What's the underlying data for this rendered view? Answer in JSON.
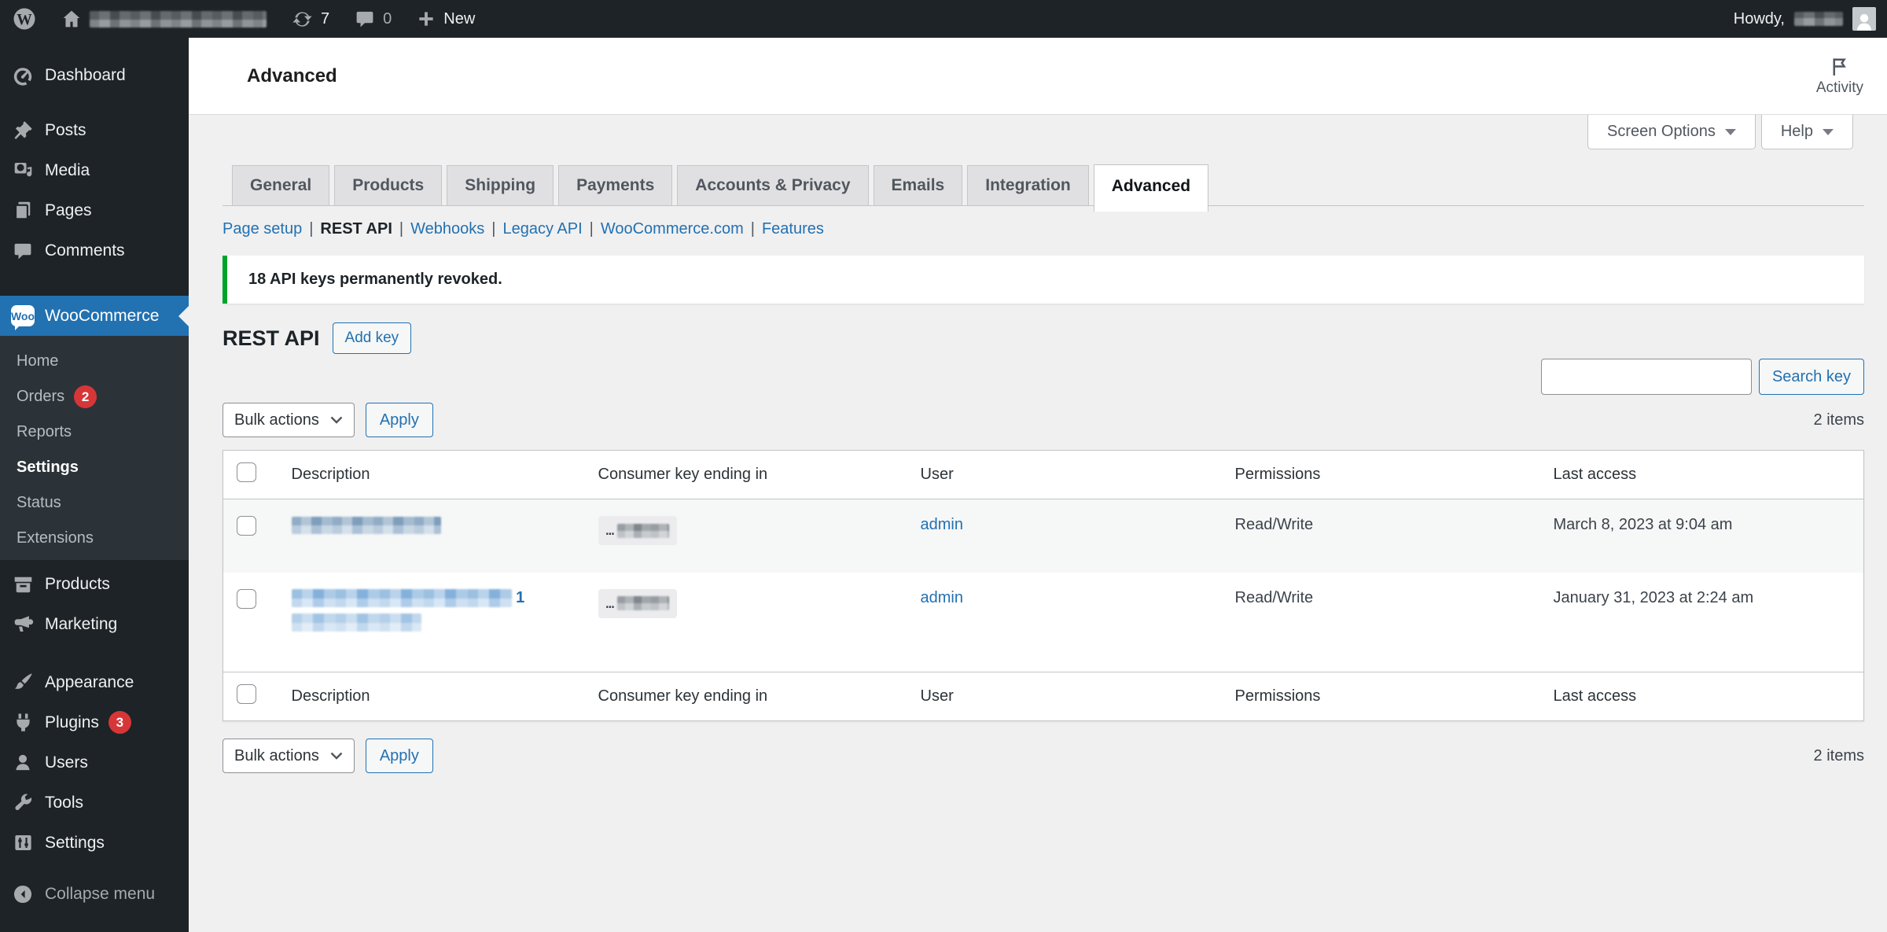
{
  "admin_bar": {
    "updates_count": "7",
    "comments_count": "0",
    "new_label": "New",
    "howdy_label": "Howdy,"
  },
  "sidebar": {
    "items": [
      {
        "label": "Dashboard"
      },
      {
        "label": "Posts"
      },
      {
        "label": "Media"
      },
      {
        "label": "Pages"
      },
      {
        "label": "Comments"
      },
      {
        "label": "WooCommerce"
      },
      {
        "label": "Products"
      },
      {
        "label": "Marketing"
      },
      {
        "label": "Appearance"
      },
      {
        "label": "Plugins"
      },
      {
        "label": "Users"
      },
      {
        "label": "Tools"
      },
      {
        "label": "Settings"
      },
      {
        "label": "Collapse menu"
      }
    ],
    "woo_icon_text": "Woo",
    "orders_badge": "2",
    "plugins_badge": "3",
    "submenu": [
      {
        "label": "Home"
      },
      {
        "label": "Orders"
      },
      {
        "label": "Reports"
      },
      {
        "label": "Settings"
      },
      {
        "label": "Status"
      },
      {
        "label": "Extensions"
      }
    ]
  },
  "header": {
    "title": "Advanced",
    "activity_label": "Activity",
    "screen_options_label": "Screen Options",
    "help_label": "Help"
  },
  "tabs": {
    "items": [
      {
        "label": "General"
      },
      {
        "label": "Products"
      },
      {
        "label": "Shipping"
      },
      {
        "label": "Payments"
      },
      {
        "label": "Accounts & Privacy"
      },
      {
        "label": "Emails"
      },
      {
        "label": "Integration"
      },
      {
        "label": "Advanced"
      }
    ],
    "active": "Advanced"
  },
  "subnav": {
    "separator": "|",
    "items": [
      {
        "label": "Page setup"
      },
      {
        "label": "REST API"
      },
      {
        "label": "Webhooks"
      },
      {
        "label": "Legacy API"
      },
      {
        "label": "WooCommerce.com"
      },
      {
        "label": "Features"
      }
    ],
    "current": "REST API"
  },
  "notice": {
    "message": "18 API keys permanently revoked."
  },
  "rest_api": {
    "heading": "REST API",
    "add_key_label": "Add key",
    "search_button_label": "Search key",
    "search_value": ""
  },
  "toolbar": {
    "bulk_actions_label": "Bulk actions",
    "apply_label": "Apply",
    "items_count": "2 items"
  },
  "table": {
    "columns": {
      "description": "Description",
      "consumer_key": "Consumer key ending in",
      "user": "User",
      "permissions": "Permissions",
      "last_access": "Last access"
    },
    "rows": [
      {
        "description_redacted": true,
        "consumer_key_prefix": "…",
        "consumer_key_redacted": true,
        "user": "admin",
        "permissions": "Read/Write",
        "last_access": "March 8, 2023 at 9:04 am"
      },
      {
        "description_redacted": true,
        "description_visible_suffix": "1",
        "consumer_key_prefix": "…",
        "consumer_key_redacted": true,
        "user": "admin",
        "permissions": "Read/Write",
        "last_access": "January 31, 2023 at 2:24 am"
      }
    ]
  },
  "colors": {
    "accent": "#2271b1",
    "menu_bg": "#1d2327",
    "submenu_bg": "#2c3338",
    "content_bg": "#f0f0f1",
    "notice_green": "#00a32a",
    "badge_red": "#d63638"
  }
}
